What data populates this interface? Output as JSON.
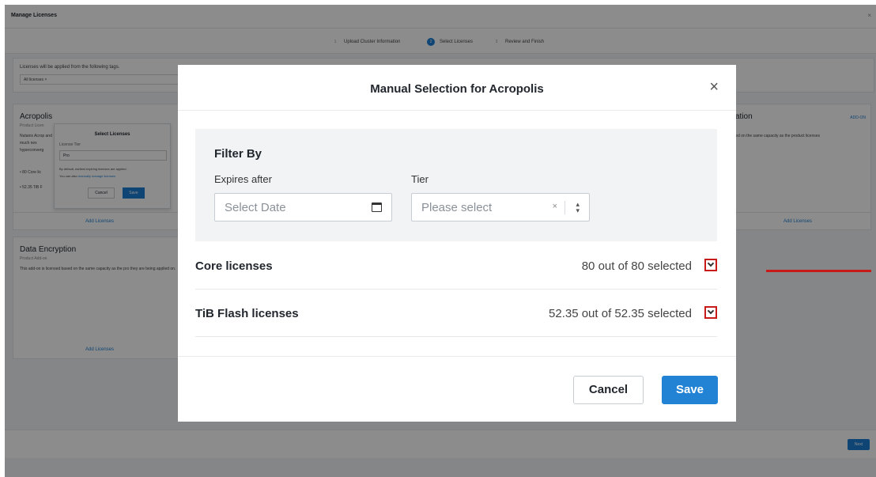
{
  "background": {
    "window_title": "Manage Licenses",
    "close": "×",
    "steps": [
      {
        "num": "1",
        "label": "Upload Cluster Information",
        "active": false
      },
      {
        "num": "2",
        "label": "Select Licenses",
        "active": true
      },
      {
        "num": "3",
        "label": "Review and Finish",
        "active": false
      }
    ],
    "tags_label": "Licenses will be applied from the following tags.",
    "tags_value": "All licenses ×",
    "acropolis": {
      "title": "Acropolis",
      "subtitle": "Product Licen",
      "text": "Nutanix Acrop and much nex hyperconverg",
      "bullets": [
        "80 Core lic",
        "52.35 TiB F"
      ],
      "add_link": "Add Licenses"
    },
    "popover": {
      "title": "Select Licenses",
      "tier_label": "License Tier",
      "tier_value": "Pro",
      "note": "By default, earliest expiring licenses are applied.",
      "note2_prefix": "You can also",
      "note2_link": "manually manage licenses",
      "cancel": "Cancel",
      "save": "Save"
    },
    "right_card": {
      "title": "cation",
      "add_on": "ADD-ON",
      "text": "ased on the same capacity as the product licenses",
      "add_link": "Add Licenses"
    },
    "encryption": {
      "title": "Data Encryption",
      "subtitle": "Product Add-on",
      "text": "This add-on is licensed based on the same capacity as the pro they are being applied on.",
      "add_link": "Add Licenses"
    },
    "next": "Next"
  },
  "modal": {
    "title": "Manual Selection for Acropolis",
    "close": "×",
    "filter": {
      "title": "Filter By",
      "expires_label": "Expires after",
      "expires_placeholder": "Select Date",
      "tier_label": "Tier",
      "tier_placeholder": "Please select",
      "clear": "×",
      "arrows": "÷"
    },
    "licenses": [
      {
        "name": "Core licenses",
        "count": "80 out of 80 selected"
      },
      {
        "name": "TiB Flash licenses",
        "count": "52.35 out of 52.35 selected"
      }
    ],
    "cancel": "Cancel",
    "save": "Save"
  },
  "colors": {
    "accent": "#2283d4",
    "highlight": "#c91a1a"
  }
}
